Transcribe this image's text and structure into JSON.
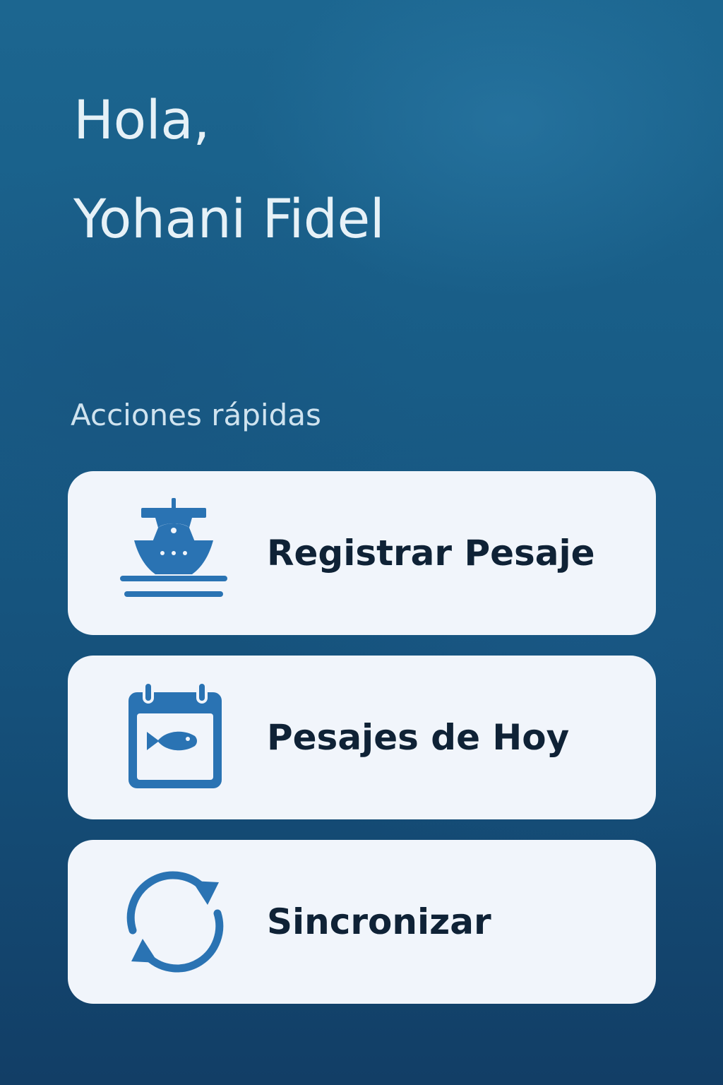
{
  "greeting": {
    "line1": "Hola,",
    "line2": "Yohani Fidel"
  },
  "quick_actions": {
    "title": "Acciones rápidas",
    "items": [
      {
        "label": "Registrar Pesaje",
        "icon": "boat-icon"
      },
      {
        "label": "Pesajes de Hoy",
        "icon": "calendar-fish-icon"
      },
      {
        "label": "Sincronizar",
        "icon": "sync-icon"
      }
    ]
  },
  "colors": {
    "background": "#185c86",
    "card": "#f1f5fb",
    "icon": "#2a73b3",
    "label_text": "#0f2236",
    "greeting_text": "#e6f1f7"
  }
}
